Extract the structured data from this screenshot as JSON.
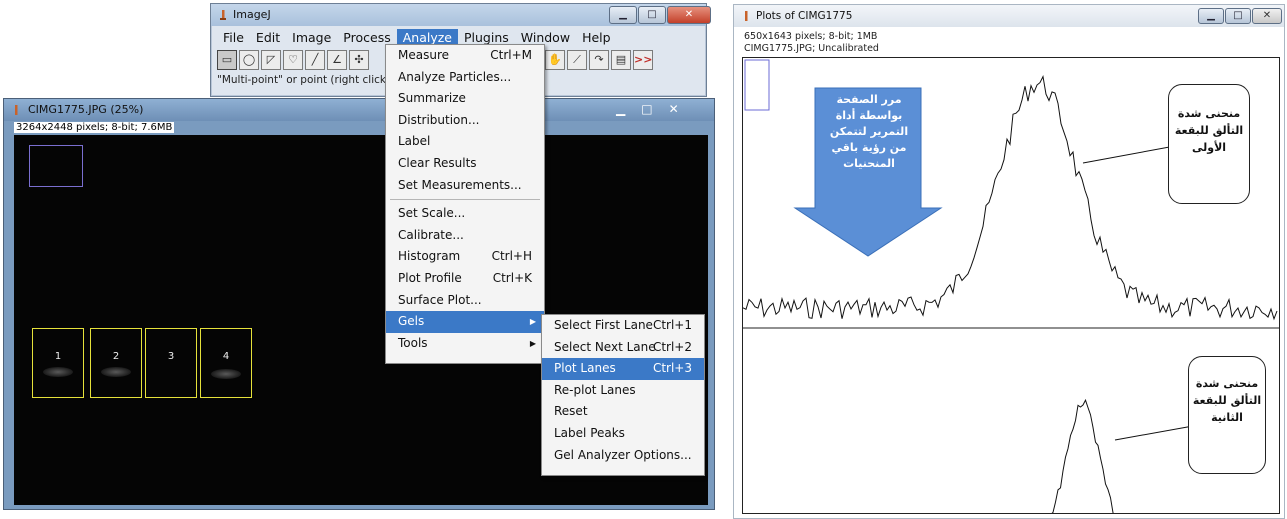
{
  "imagej": {
    "title": "ImageJ",
    "menus": [
      "File",
      "Edit",
      "Image",
      "Process",
      "Analyze",
      "Plugins",
      "Window",
      "Help"
    ],
    "active_menu": "Analyze",
    "status": "\"Multi-point\" or point (right click to",
    "tool_icons": [
      "rectangle-tool-icon",
      "oval-tool-icon",
      "polygon-tool-icon",
      "freehand-tool-icon",
      "line-tool-icon",
      "angle-tool-icon",
      "multipoint-tool-icon"
    ],
    "right_tool_icons": [
      "dropper-icon",
      "hand-icon",
      "pipette-icon",
      "arrow-tool-icon",
      "lut-icon",
      "more-tools-icon"
    ],
    "more_label": ">>"
  },
  "image_window": {
    "title": "CIMG1775.JPG (25%)",
    "info": "3264x2448 pixels; 8-bit; 7.6MB",
    "lanes": [
      {
        "label": "1"
      },
      {
        "label": "2"
      },
      {
        "label": "3"
      },
      {
        "label": "4"
      }
    ]
  },
  "analyze_menu": {
    "items": [
      {
        "label": "Measure",
        "shortcut": "Ctrl+M"
      },
      {
        "label": "Analyze Particles...",
        "shortcut": ""
      },
      {
        "label": "Summarize",
        "shortcut": ""
      },
      {
        "label": "Distribution...",
        "shortcut": ""
      },
      {
        "label": "Label",
        "shortcut": ""
      },
      {
        "label": "Clear Results",
        "shortcut": ""
      },
      {
        "label": "Set Measurements...",
        "shortcut": ""
      },
      {
        "sep": true
      },
      {
        "label": "Set Scale...",
        "shortcut": ""
      },
      {
        "label": "Calibrate...",
        "shortcut": ""
      },
      {
        "label": "Histogram",
        "shortcut": "Ctrl+H"
      },
      {
        "label": "Plot Profile",
        "shortcut": "Ctrl+K"
      },
      {
        "label": "Surface Plot...",
        "shortcut": ""
      },
      {
        "label": "Gels",
        "shortcut": "",
        "submenu": true,
        "highlighted": true
      },
      {
        "label": "Tools",
        "shortcut": "",
        "submenu": true
      }
    ]
  },
  "gels_menu": {
    "items": [
      {
        "label": "Select First Lane",
        "shortcut": "Ctrl+1"
      },
      {
        "label": "Select Next Lane",
        "shortcut": "Ctrl+2"
      },
      {
        "label": "Plot Lanes",
        "shortcut": "Ctrl+3",
        "highlighted": true
      },
      {
        "label": "Re-plot Lanes",
        "shortcut": ""
      },
      {
        "label": "Reset",
        "shortcut": ""
      },
      {
        "label": "Label Peaks",
        "shortcut": ""
      },
      {
        "label": "Gel Analyzer Options...",
        "shortcut": ""
      }
    ]
  },
  "plot_window": {
    "title": "Plots of CIMG1775",
    "info": "650x1643 pixels; 8-bit; 1MB",
    "subtitle": "CIMG1775.JPG; Uncalibrated",
    "scroll_annotation": "مرر الصفحة بواسطة أداة التمرير لتتمكن من رؤية باقي المنحنيات",
    "callout_1": "منحنى شدة التألق للبقعة الأولى",
    "callout_2": "منحنى شدة التألق للبقعة الثانية"
  },
  "colors": {
    "menu_highlight": "#3b79c7",
    "lane_roi": "#e6e23a",
    "arrow_fill": "#5b8fd6"
  }
}
